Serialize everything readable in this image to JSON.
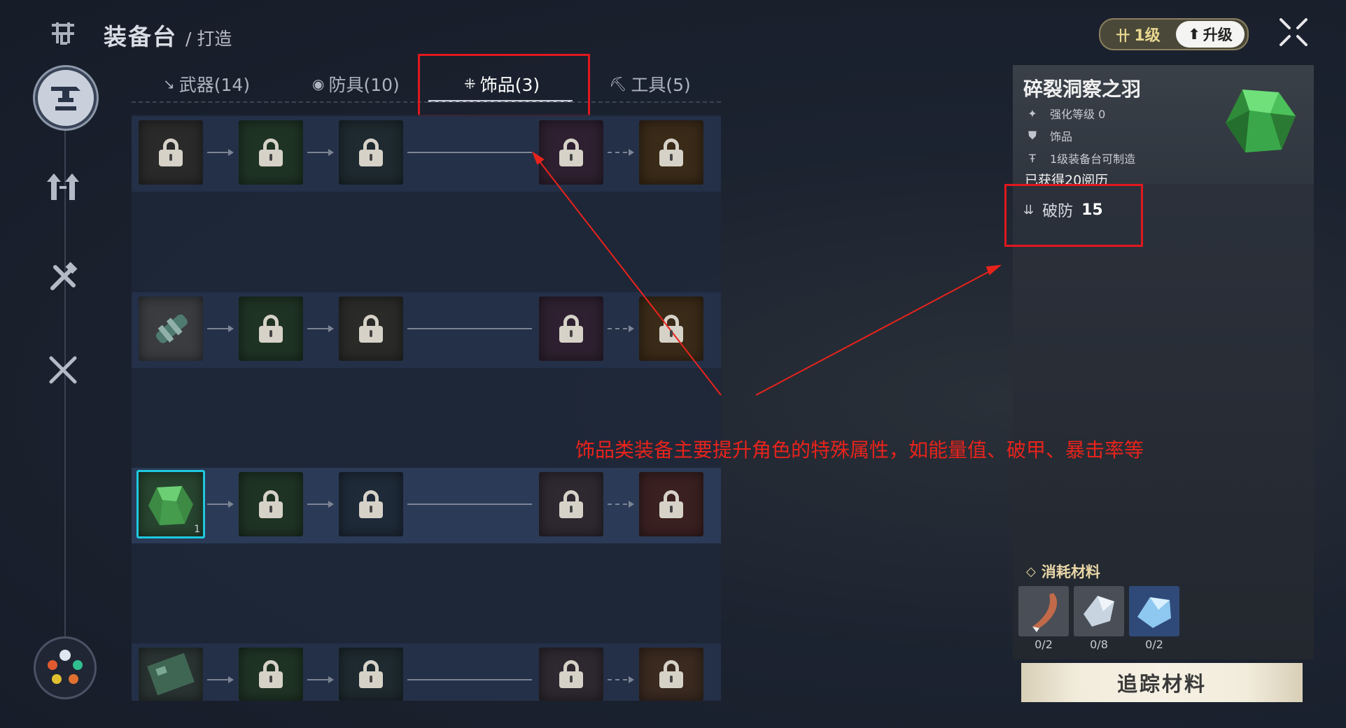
{
  "header": {
    "title": "装备台",
    "subtitle": "/ 打造",
    "level_label": "1级",
    "upgrade_label": "升级"
  },
  "tabs": [
    {
      "label": "武器(14)",
      "icon": "sword-icon"
    },
    {
      "label": "防具(10)",
      "icon": "armor-icon"
    },
    {
      "label": "饰品(3)",
      "icon": "accessory-icon",
      "active": true
    },
    {
      "label": "工具(5)",
      "icon": "pickaxe-icon"
    }
  ],
  "grid": {
    "rows": [
      {
        "type": "locked-chain",
        "colors": [
          "#2a2a2a",
          "#1f3324",
          "#1e2a30",
          "#2e2030",
          "#3a2a18"
        ]
      },
      {
        "type": "gear-chain",
        "colors": [
          "#3a3c40",
          "#1f3324",
          "#2a2a28",
          "#2e2030",
          "#3a2a18"
        ]
      },
      {
        "type": "gem-chain",
        "selected": true,
        "count": "1",
        "colors": [
          "#284530",
          "#1f3324",
          "#1e2a38",
          "#2e2830",
          "#3a2020"
        ]
      },
      {
        "type": "circuit-chain",
        "colors": [
          "#2a3432",
          "#1f3324",
          "#1e2a30",
          "#2e2830",
          "#3a2a20"
        ]
      }
    ]
  },
  "detail": {
    "name": "碎裂洞察之羽",
    "enhance_level": "强化等级 0",
    "category": "饰品",
    "craft_requirement": "1级装备台可制造",
    "obtained": "已获得20阅历",
    "stat_label": "破防",
    "stat_value": "15"
  },
  "materials": {
    "title": "消耗材料",
    "items": [
      {
        "icon": "fang-icon",
        "count": "0/2",
        "color": "#4a4e56"
      },
      {
        "icon": "ore-icon",
        "count": "0/8",
        "color": "#4a4e56"
      },
      {
        "icon": "crystal-icon",
        "count": "0/2",
        "color": "#2f4a78"
      }
    ],
    "track_button": "追踪材料"
  },
  "annotation": "饰品类装备主要提升角色的特殊属性，如能量值、破甲、暴击率等",
  "colors": {
    "annotation": "#e8231c",
    "selected_border": "#1ec8e0",
    "gem_green": "#3fb04a"
  }
}
